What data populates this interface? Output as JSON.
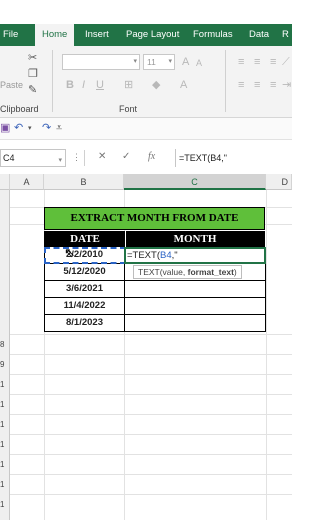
{
  "ribbon_tabs": [
    "File",
    "Home",
    "Insert",
    "Page Layout",
    "Formulas",
    "Data",
    "R"
  ],
  "active_tab": "Home",
  "clipboard": {
    "paste_label": "Paste",
    "group_label": "Clipboard"
  },
  "font_group": {
    "font_size": "11",
    "group_label": "Font"
  },
  "formula_bar": {
    "name_box": "C4",
    "cancel_icon": "✕",
    "enter_icon": "✓",
    "fx_label": "fx",
    "formula": "=TEXT(B4,\""
  },
  "columns": [
    "A",
    "B",
    "C",
    "D"
  ],
  "table": {
    "title": "EXTRACT MONTH FROM DATE",
    "headers": [
      "DATE",
      "MONTH"
    ],
    "dates": [
      "2/2/2010",
      "5/12/2020",
      "3/6/2021",
      "11/4/2022",
      "8/1/2023"
    ]
  },
  "editing": {
    "prefix": "=TEXT(",
    "ref": "B4",
    "suffix": ",\""
  },
  "tooltip": {
    "fn": "TEXT(value, ",
    "arg": "format_text",
    "close": ")"
  },
  "row_digits": [
    "8",
    "9",
    "1",
    "1",
    "1",
    "1",
    "1",
    "1",
    "1"
  ],
  "colors": {
    "excel_green": "#217346",
    "title_fill": "#5fbf3a",
    "header_fill": "#000000"
  }
}
